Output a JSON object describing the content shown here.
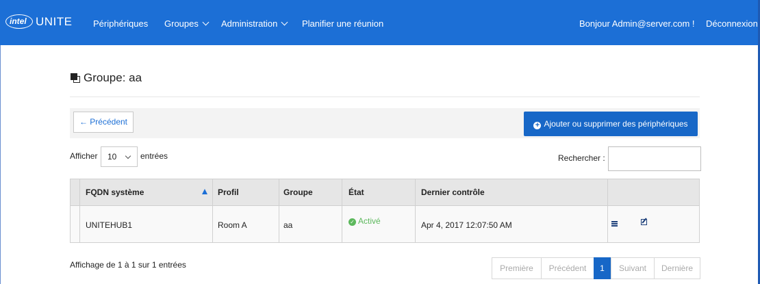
{
  "nav": {
    "logo_brand": "intel",
    "logo_product": "UNITE",
    "items": [
      "Périphériques",
      "Groupes",
      "Administration",
      "Planifier une réunion"
    ],
    "greeting": "Bonjour Admin@server.com !",
    "logout": "Déconnexion",
    "bar_color": "#1c6fd6"
  },
  "page": {
    "title": "Groupe: aa",
    "back_button": "← Précédent",
    "add_button": "Ajouter ou supprimer des périphériques"
  },
  "controls": {
    "show_label": "Afficher",
    "page_size": "10",
    "entries_label": "entrées",
    "search_label": "Rechercher :",
    "search_value": ""
  },
  "table": {
    "columns": [
      "FQDN système",
      "Profil",
      "Groupe",
      "État",
      "Dernier contrôle"
    ],
    "sort_column": "FQDN système",
    "sort_direction": "ascending",
    "rows": [
      {
        "fqdn": "UNITEHUB1",
        "profile": "Room A",
        "group": "aa",
        "status": "Activé",
        "last_check": "Apr 4, 2017 12:07:50 AM"
      }
    ]
  },
  "footer": {
    "info": "Affichage de 1 à 1 sur 1 entrées",
    "pagination": [
      "Première",
      "Précédent",
      "1",
      "Suivant",
      "Dernière"
    ],
    "current_page": "1"
  },
  "icons": [
    "group-icon",
    "plus-circle-icon",
    "chevron-down-icon",
    "sort-ascending-icon",
    "check-circle-icon",
    "details-list-icon",
    "edit-icon"
  ]
}
